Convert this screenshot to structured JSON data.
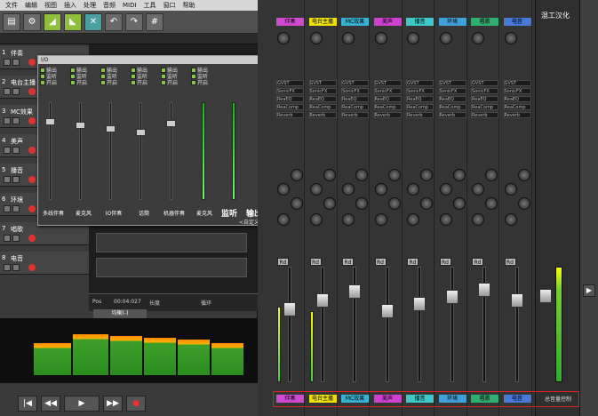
{
  "menubar": [
    "文件",
    "编辑",
    "视图",
    "插入",
    "处理",
    "音频",
    "MIDI",
    "工具",
    "窗口",
    "帮助"
  ],
  "tracks": [
    {
      "num": "1",
      "name": "伴奏"
    },
    {
      "num": "2",
      "name": "电台主播"
    },
    {
      "num": "3",
      "name": "MC效果"
    },
    {
      "num": "4",
      "name": "美声"
    },
    {
      "num": "5",
      "name": "播音"
    },
    {
      "num": "6",
      "name": "环境"
    },
    {
      "num": "7",
      "name": "唱歌"
    },
    {
      "num": "8",
      "name": "电音"
    }
  ],
  "popup": {
    "title": "I/O",
    "checks": [
      "输出",
      "监听",
      "开启"
    ],
    "channels": [
      "多线伴奏",
      "麦克风",
      "IO伴奏",
      "话筒",
      "机器伴奏",
      "麦克风"
    ],
    "monitor": "监听",
    "output": "输出",
    "default": "<自定义>"
  },
  "info": {
    "pos": "Pos",
    "time": "00:04:027",
    "len": "长度",
    "loop": "循环"
  },
  "eq_tab": "均衡(-)",
  "transport": [
    "|◀",
    "◀◀",
    "▶",
    "▶▶",
    "●"
  ],
  "mixer": {
    "strips": [
      {
        "name": "伴奏",
        "color": "#d04bd0"
      },
      {
        "name": "电台主播",
        "color": "#f0e000"
      },
      {
        "name": "MC效果",
        "color": "#3ab0d0"
      },
      {
        "name": "美声",
        "color": "#d040d0"
      },
      {
        "name": "播音",
        "color": "#40c8c8"
      },
      {
        "name": "环境",
        "color": "#40a0d8"
      },
      {
        "name": "唱歌",
        "color": "#30b070"
      },
      {
        "name": "电音",
        "color": "#4878d8"
      }
    ],
    "fx": [
      "GVST",
      "SonicFX",
      "ReaEQ",
      "ReaComp",
      "Reverb"
    ],
    "master_label": "混工汉化",
    "master_bottom": "总音量控制",
    "rd": "Rd",
    "mute": "M",
    "solo": "S"
  }
}
